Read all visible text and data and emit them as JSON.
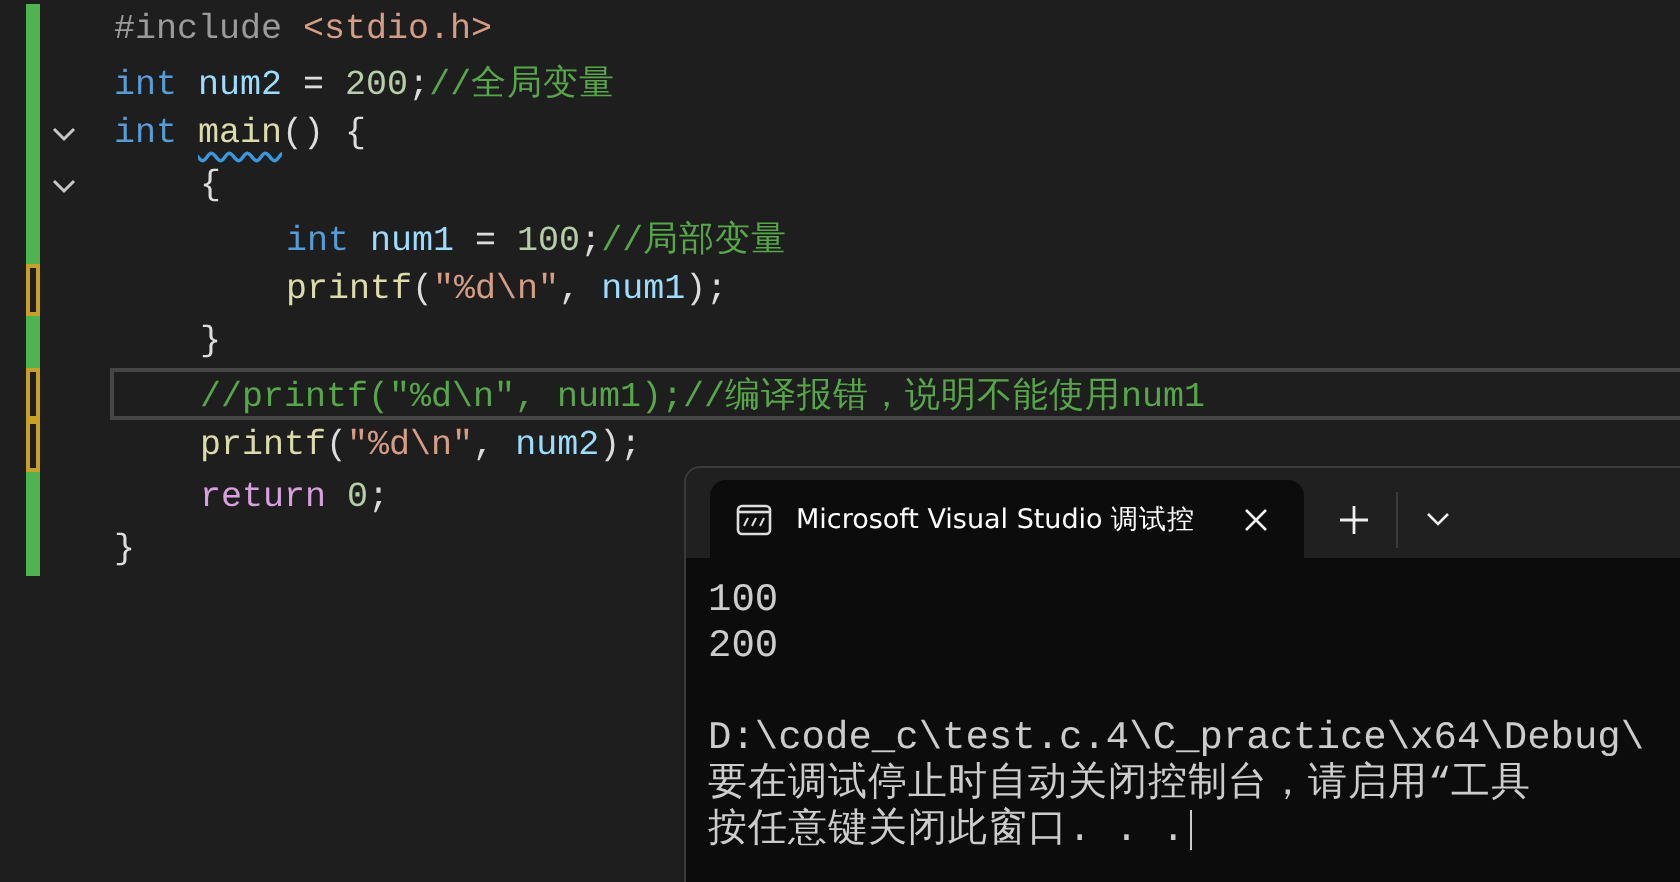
{
  "editor": {
    "lines": [
      {
        "modified": false,
        "current": false,
        "tokens": [
          {
            "kind": "preproc",
            "text": "#include "
          },
          {
            "kind": "string",
            "text": "<stdio.h>"
          }
        ]
      },
      {
        "modified": false,
        "current": false,
        "tokens": [
          {
            "kind": "keyword",
            "text": "int "
          },
          {
            "kind": "ident",
            "text": "num2 "
          },
          {
            "kind": "punct",
            "text": "= "
          },
          {
            "kind": "number",
            "text": "200"
          },
          {
            "kind": "punct",
            "text": ";"
          },
          {
            "kind": "comment",
            "text": "//全局变量"
          }
        ]
      },
      {
        "modified": false,
        "current": false,
        "fold": {
          "expanded": true
        },
        "tokens": [
          {
            "kind": "keyword",
            "text": "int "
          },
          {
            "kind": "func",
            "text": "main",
            "squiggle": true
          },
          {
            "kind": "punct",
            "text": "() {"
          }
        ],
        "children": [
          {
            "modified": false,
            "current": false,
            "fold": {
              "expanded": true
            },
            "tokens": [
              {
                "kind": "punct",
                "text": "{"
              }
            ],
            "children": [
              {
                "modified": false,
                "current": false,
                "tokens": [
                  {
                    "kind": "keyword",
                    "text": "int "
                  },
                  {
                    "kind": "ident",
                    "text": "num1 "
                  },
                  {
                    "kind": "punct",
                    "text": "= "
                  },
                  {
                    "kind": "number",
                    "text": "100"
                  },
                  {
                    "kind": "punct",
                    "text": ";"
                  },
                  {
                    "kind": "comment",
                    "text": "//局部变量"
                  }
                ]
              },
              {
                "modified": true,
                "current": false,
                "tokens": [
                  {
                    "kind": "func",
                    "text": "printf"
                  },
                  {
                    "kind": "punct",
                    "text": "("
                  },
                  {
                    "kind": "string",
                    "text": "\"%d\\n\""
                  },
                  {
                    "kind": "punct",
                    "text": ", "
                  },
                  {
                    "kind": "ident",
                    "text": "num1"
                  },
                  {
                    "kind": "punct",
                    "text": ");"
                  }
                ]
              }
            ]
          },
          {
            "modified": false,
            "current": false,
            "tokens": [
              {
                "kind": "punct",
                "text": "}"
              }
            ]
          },
          {
            "modified": true,
            "current": true,
            "tokens": [
              {
                "kind": "comment",
                "text": "//printf(\"%d\\n\", num1);//编译报错，说明不能使用num1"
              }
            ]
          },
          {
            "modified": true,
            "current": false,
            "tokens": [
              {
                "kind": "func",
                "text": "printf"
              },
              {
                "kind": "punct",
                "text": "("
              },
              {
                "kind": "string",
                "text": "\"%d\\n\""
              },
              {
                "kind": "punct",
                "text": ", "
              },
              {
                "kind": "ident",
                "text": "num2"
              },
              {
                "kind": "punct",
                "text": ");"
              }
            ]
          },
          {
            "modified": false,
            "current": false,
            "tokens": [
              {
                "kind": "control",
                "text": "return "
              },
              {
                "kind": "number",
                "text": "0"
              },
              {
                "kind": "punct",
                "text": ";"
              }
            ]
          }
        ]
      },
      {
        "modified": false,
        "current": false,
        "tokens": [
          {
            "kind": "punct",
            "text": "}"
          }
        ]
      }
    ]
  },
  "terminal": {
    "tab": {
      "title": "Microsoft Visual Studio 调试控",
      "selected": true
    },
    "program_output": [
      "100",
      "200"
    ],
    "messages": [
      "D:\\code_c\\test.c.4\\C_practice\\x64\\Debug\\",
      "要在调试停止时自动关闭控制台，请启用“工具",
      "按任意键关闭此窗口. . ."
    ]
  }
}
